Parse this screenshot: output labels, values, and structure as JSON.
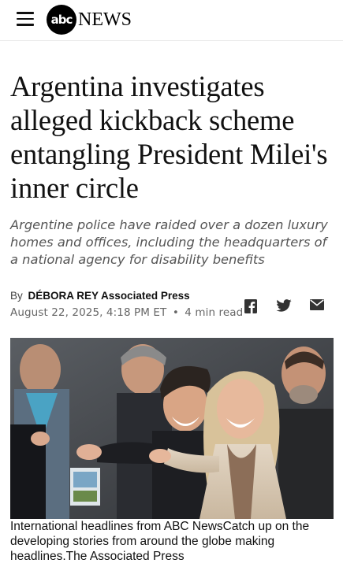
{
  "header": {
    "logo_abc": "abc",
    "logo_news": "NEWS",
    "menu_icon": "hamburger-menu-icon"
  },
  "article": {
    "headline": "Argentina investigates alleged kickback scheme entangling President Milei's inner circle",
    "subheadline": "Argentine police have raided over a dozen luxury homes and offices, including the headquarters of a national agency for disability benefits",
    "byline_prefix": "By",
    "author": "DÉBORA REY Associated Press",
    "date": "August 22, 2025, 4:18 PM ET",
    "separator": "•",
    "read_time": "4 min read",
    "share_icons": [
      "facebook-icon",
      "twitter-icon",
      "email-icon"
    ],
    "photo_caption": "International headlines from ABC NewsCatch up on the developing stories from around the globe making headlines.The Associated Press"
  }
}
